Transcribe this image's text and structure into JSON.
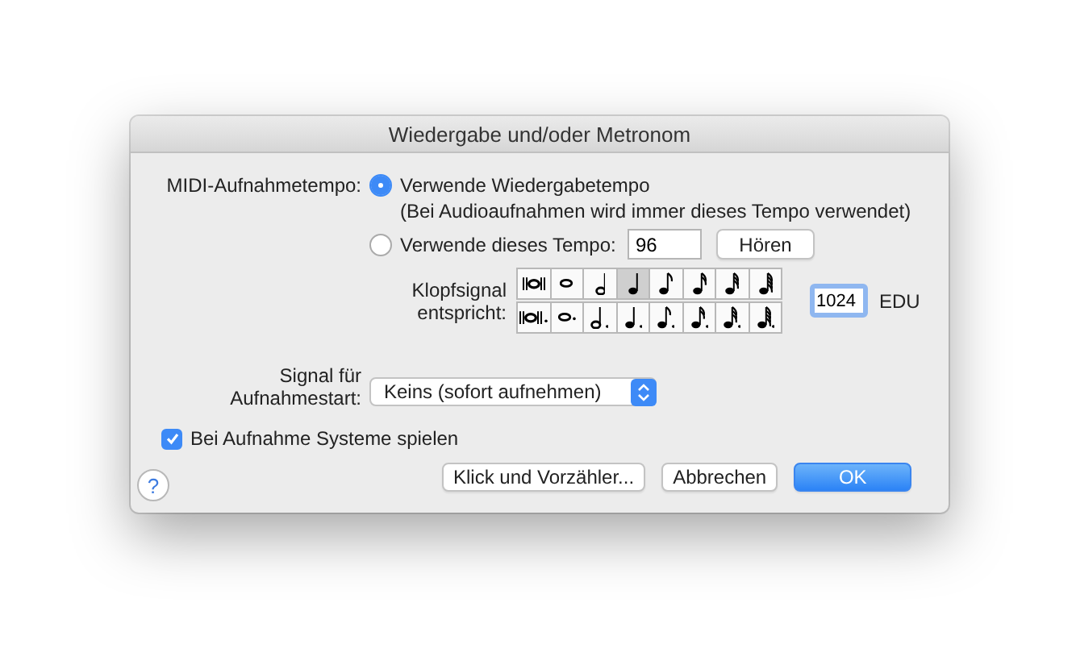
{
  "window": {
    "title": "Wiedergabe und/oder Metronom"
  },
  "midi_tempo": {
    "label": "MIDI-Aufnahmetempo:",
    "options": [
      {
        "label": "Verwende Wiedergabetempo",
        "note": "(Bei Audioaufnahmen wird immer dieses Tempo verwendet)",
        "selected": true
      },
      {
        "label": "Verwende dieses Tempo:",
        "selected": false
      }
    ],
    "tempo_field": {
      "value": "96"
    },
    "listen_button": "Hören"
  },
  "beat": {
    "label_lines": [
      "Klopfsignal",
      "entspricht:"
    ],
    "rows": [
      {
        "dotted": false,
        "notes": [
          {
            "kind": "breve",
            "selected": false
          },
          {
            "kind": "whole",
            "selected": false
          },
          {
            "kind": "half",
            "selected": false
          },
          {
            "kind": "quarter",
            "selected": true
          },
          {
            "kind": "eighth",
            "selected": false
          },
          {
            "kind": "sixteenth",
            "selected": false
          },
          {
            "kind": "thirtysecond",
            "selected": false
          },
          {
            "kind": "sixtyfourth",
            "selected": false
          }
        ]
      },
      {
        "dotted": true,
        "notes": [
          {
            "kind": "breve",
            "selected": false
          },
          {
            "kind": "whole",
            "selected": false
          },
          {
            "kind": "half",
            "selected": false
          },
          {
            "kind": "quarter",
            "selected": false
          },
          {
            "kind": "eighth",
            "selected": false
          },
          {
            "kind": "sixteenth",
            "selected": false
          },
          {
            "kind": "thirtysecond",
            "selected": false
          },
          {
            "kind": "sixtyfourth",
            "selected": false
          }
        ]
      }
    ],
    "edu_field": {
      "value": "1024"
    },
    "unit": "EDU"
  },
  "start_signal": {
    "label_lines": [
      "Signal für",
      "Aufnahmestart:"
    ],
    "value": "Keins (sofort aufnehmen)"
  },
  "play_systems": {
    "label": "Bei Aufnahme Systeme spielen",
    "checked": true
  },
  "help": "?",
  "buttons": [
    {
      "label": "Klick und Vorzähler...",
      "kind": "default"
    },
    {
      "label": "Abbrechen",
      "kind": "default"
    },
    {
      "label": "OK",
      "kind": "primary"
    }
  ]
}
